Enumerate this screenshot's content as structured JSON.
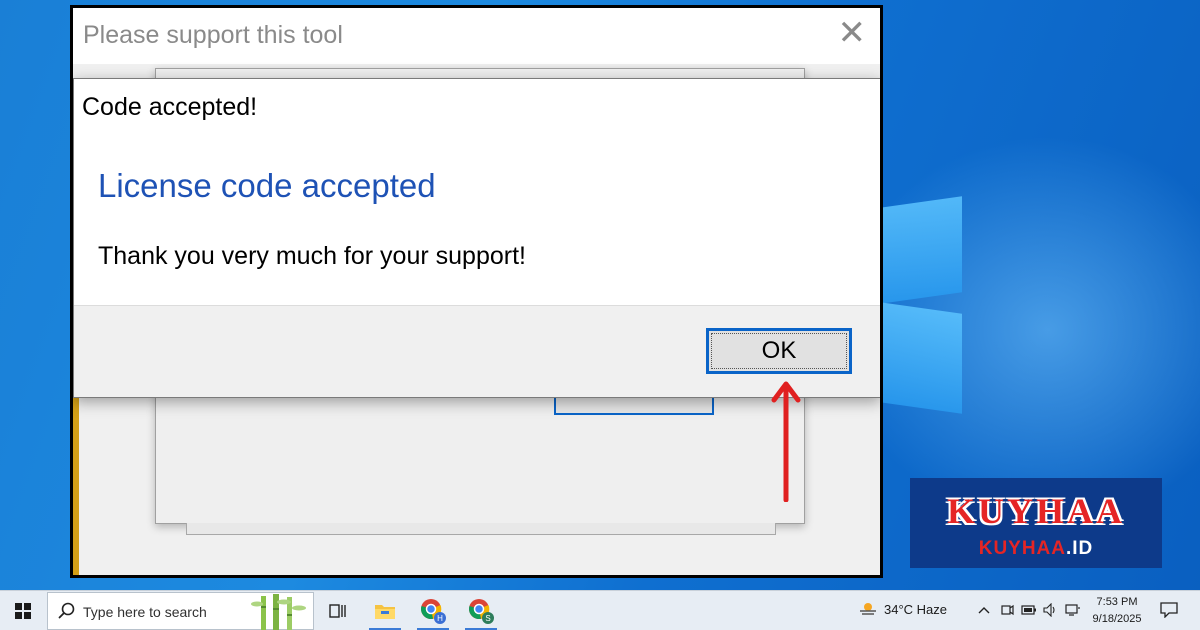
{
  "dialog": {
    "window_title": "Please support this tool",
    "close_glyph": "✕",
    "message_title": "Code accepted!",
    "heading": "License code accepted",
    "body": "Thank you very much for your support!",
    "ok_label": "OK"
  },
  "watermark": {
    "brand": "KUYHAA",
    "domain_name": "KUYHAA",
    "domain_tld": ".ID"
  },
  "taskbar": {
    "search_placeholder": "Type here to search",
    "weather": "34°C  Haze",
    "time": "7:53 PM",
    "date": "9/18/2025",
    "chrome_profile_1": "H",
    "chrome_profile_2": "S",
    "tray_icons": [
      "chevron-up-icon",
      "meet-icon",
      "battery-icon",
      "volume-icon",
      "network-icon"
    ]
  },
  "colors": {
    "accent": "#0a64c8",
    "heading": "#1e52b5",
    "arrow": "#e02020",
    "watermark_bg": "#0d3a8a",
    "watermark_red": "#e52525"
  }
}
